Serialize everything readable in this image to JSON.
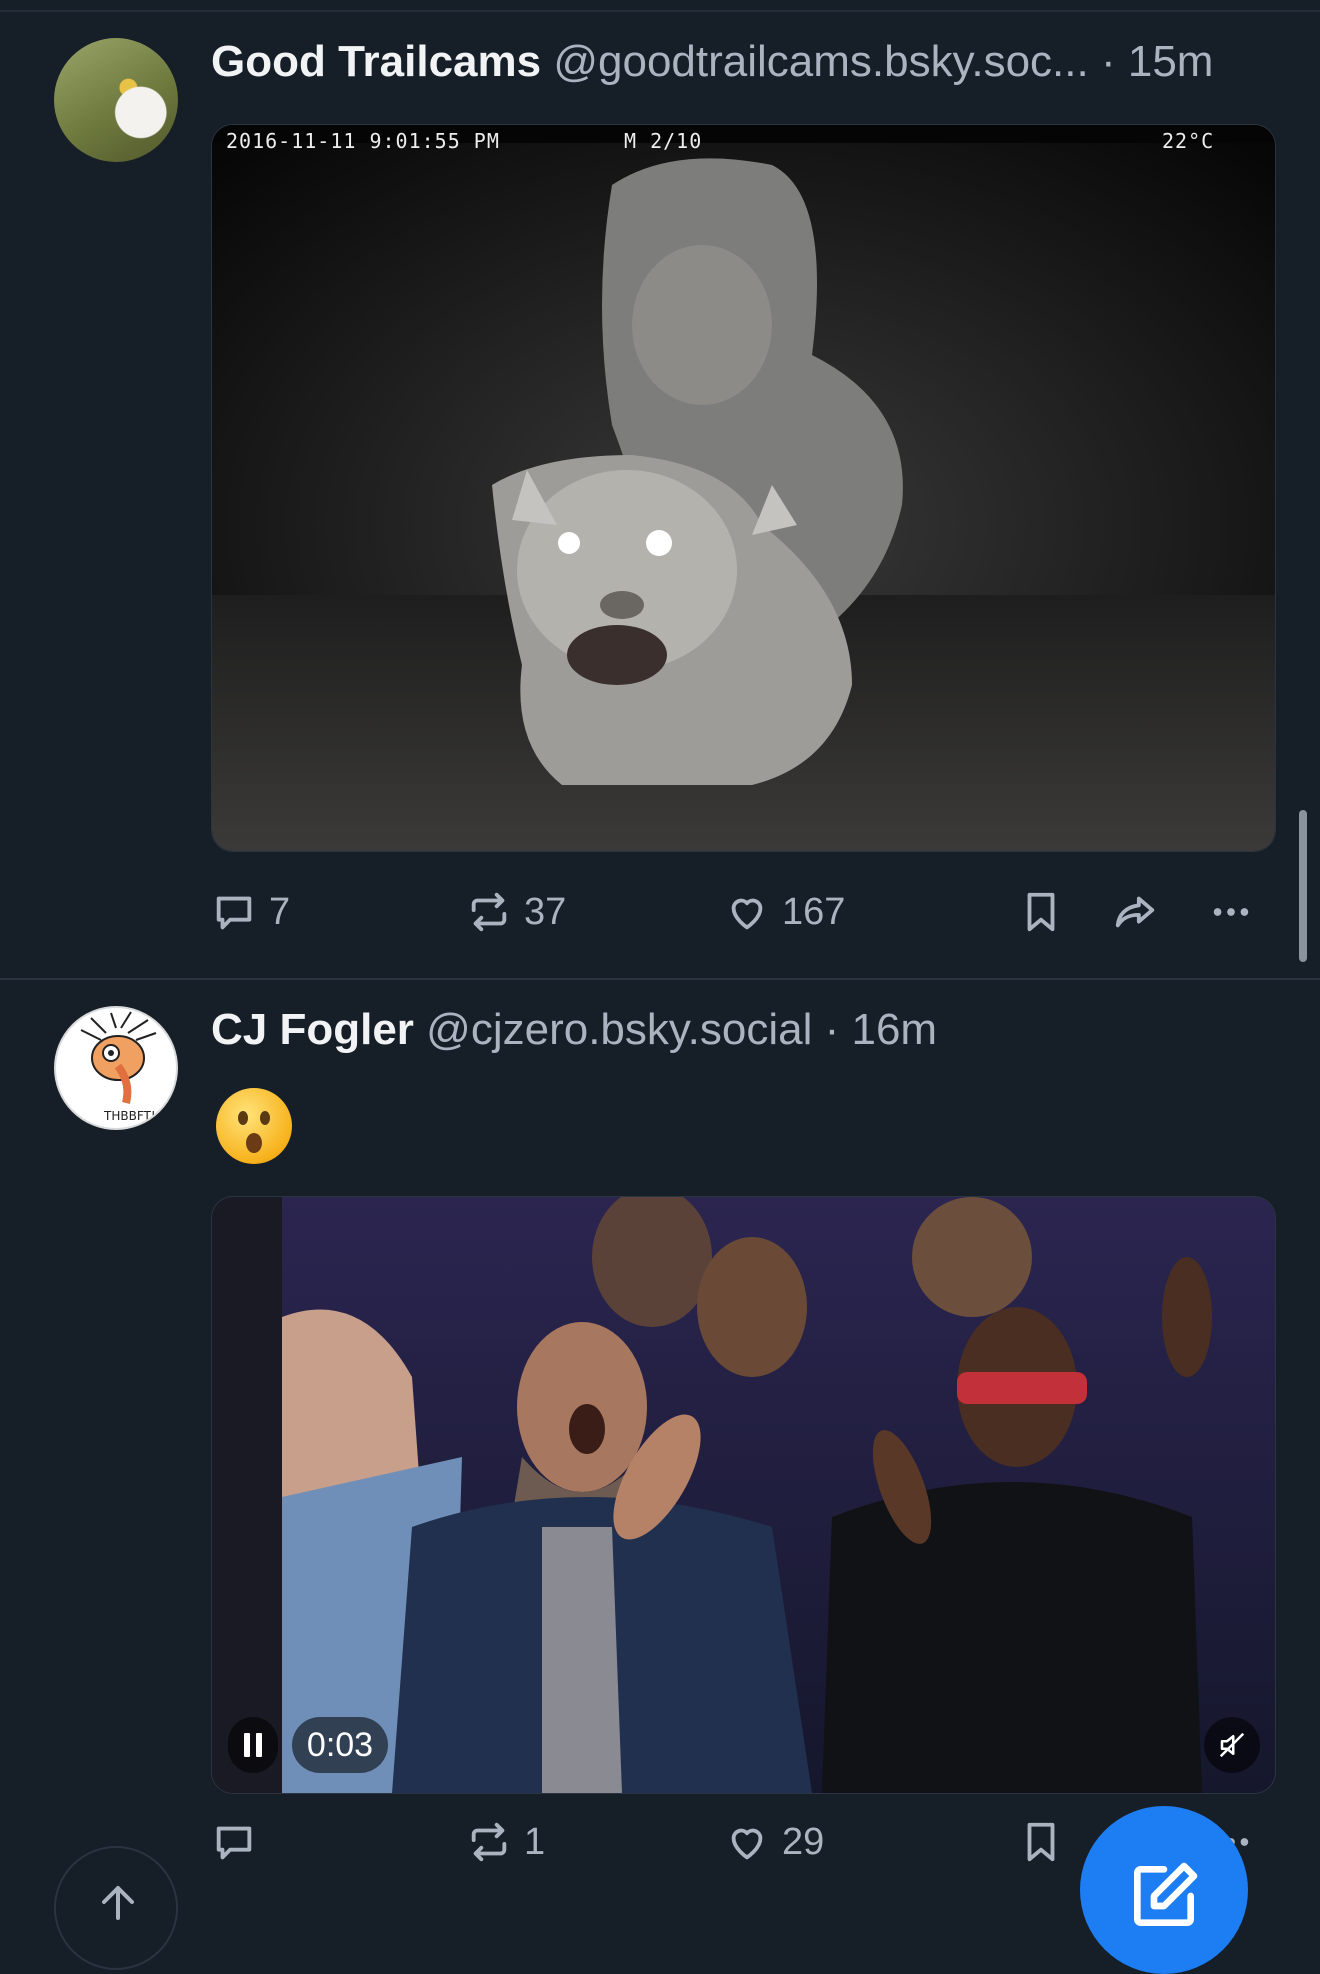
{
  "posts": [
    {
      "author_name": "Good Trailcams",
      "handle": "@goodtrailcams.bsky.soc...",
      "separator": "·",
      "time": "15m",
      "image_overlay": {
        "timestamp": "2016-11-11  9:01:55 PM",
        "camera": "M 2/10",
        "temperature": "22°C"
      },
      "replies": "7",
      "reposts": "37",
      "likes": "167"
    },
    {
      "author_name": "CJ Fogler",
      "handle": "@cjzero.bsky.social",
      "separator": "·",
      "time": "16m",
      "emoji": "astonished-face",
      "avatar_text": "THBBFT!",
      "video": {
        "elapsed": "0:03",
        "state": "playing",
        "muted": true
      },
      "replies": "",
      "reposts": "1",
      "likes": "29"
    }
  ],
  "colors": {
    "background": "#161e27",
    "accent": "#1d7df2",
    "muted_text": "#aab4c0"
  }
}
